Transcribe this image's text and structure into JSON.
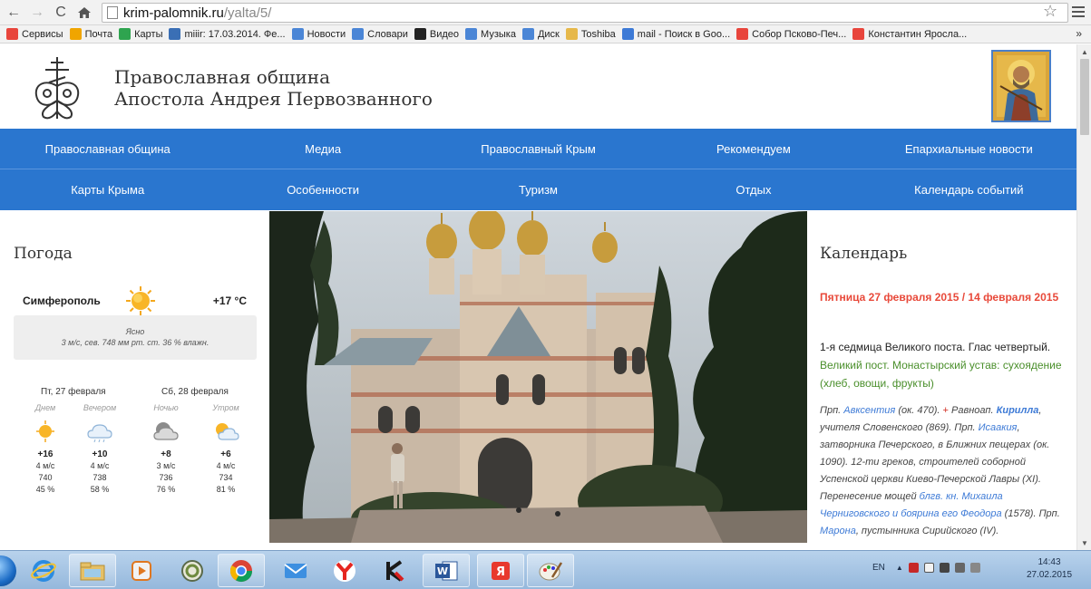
{
  "browser": {
    "url_host": "krim-palomnik.ru",
    "url_path": "/yalta/5/",
    "bookmarks": [
      {
        "label": "Сервисы",
        "color": "#e8453c"
      },
      {
        "label": "Почта",
        "color": "#f0a500"
      },
      {
        "label": "Карты",
        "color": "#2ea44f"
      },
      {
        "label": "miiir: 17.03.2014. Фе...",
        "color": "#3a6fb5"
      },
      {
        "label": "Новости",
        "color": "#4b86d6"
      },
      {
        "label": "Словари",
        "color": "#4b86d6"
      },
      {
        "label": "Видео",
        "color": "#222222"
      },
      {
        "label": "Музыка",
        "color": "#4b86d6"
      },
      {
        "label": "Диск",
        "color": "#4b86d6"
      },
      {
        "label": "Toshiba",
        "color": "#e6b84a"
      },
      {
        "label": "mail - Поиск в Goo...",
        "color": "#3d7ad6"
      },
      {
        "label": "Собор Псково-Печ...",
        "color": "#e8453c"
      },
      {
        "label": "Константин Яросла...",
        "color": "#e8453c"
      }
    ],
    "more": "»"
  },
  "site": {
    "title_line1": "Православная община",
    "title_line2": "Апостола Андрея Первозванного",
    "nav_row1": [
      "Православная община",
      "Медиа",
      "Православный Крым",
      "Рекомендуем",
      "Епархиальные новости"
    ],
    "nav_row2": [
      "Карты Крыма",
      "Особенности",
      "Туризм",
      "Отдых",
      "Календарь событий"
    ]
  },
  "weather": {
    "title": "Погода",
    "city": "Симферополь",
    "temp": "+17 °C",
    "condition": "Ясно",
    "details": "3 м/с, сев.  748 мм рт. ст.  36 % влажн.",
    "day1": "Пт, 27 февраля",
    "day2": "Сб, 28 февраля",
    "forecast": [
      {
        "period": "Днем",
        "icon": "sun-icon",
        "temp": "+16",
        "wind": "4 м/с",
        "pressure": "740",
        "humidity": "45 %"
      },
      {
        "period": "Вечером",
        "icon": "cloud-icon",
        "temp": "+10",
        "wind": "4 м/с",
        "pressure": "738",
        "humidity": "58 %"
      },
      {
        "period": "Ночью",
        "icon": "cloudy-moon-icon",
        "temp": "+8",
        "wind": "3 м/с",
        "pressure": "736",
        "humidity": "76 %"
      },
      {
        "period": "Утром",
        "icon": "partly-cloudy-icon",
        "temp": "+6",
        "wind": "4 м/с",
        "pressure": "734",
        "humidity": "81 %"
      }
    ]
  },
  "calendar": {
    "title": "Календарь",
    "date": "Пятница 27 февраля 2015 / 14 февраля 2015",
    "week": "1-я седмица Великого поста. Глас четвертый.",
    "fast": "Великий пост. Монастырский устав: сухоядение (хлеб, овощи, фрукты)",
    "saints": {
      "s1": "Прп.",
      "l1": "Авксентия",
      "s2": "(ок. 470).",
      "cross": "+",
      "s3": "Равноап.",
      "l2": "Кирилла",
      "s4": ", учителя Словенского (869). Прп.",
      "l3": "Исаакия",
      "s5": ", затворника Печерского, в Ближних пещерах (ок. 1090). 12-ти греков, строителей соборной Успенской церкви Киево-Печерской Лавры (XI). Перенесение мощей",
      "l4": "блгв. кн. Михаила Черниговского и боярина его Феодора",
      "s6": "(1578). Прп.",
      "l5": "Марона",
      "s7": ", пустынника Сирийского (IV)."
    }
  },
  "taskbar": {
    "lang": "EN",
    "time": "14:43",
    "date": "27.02.2015"
  }
}
